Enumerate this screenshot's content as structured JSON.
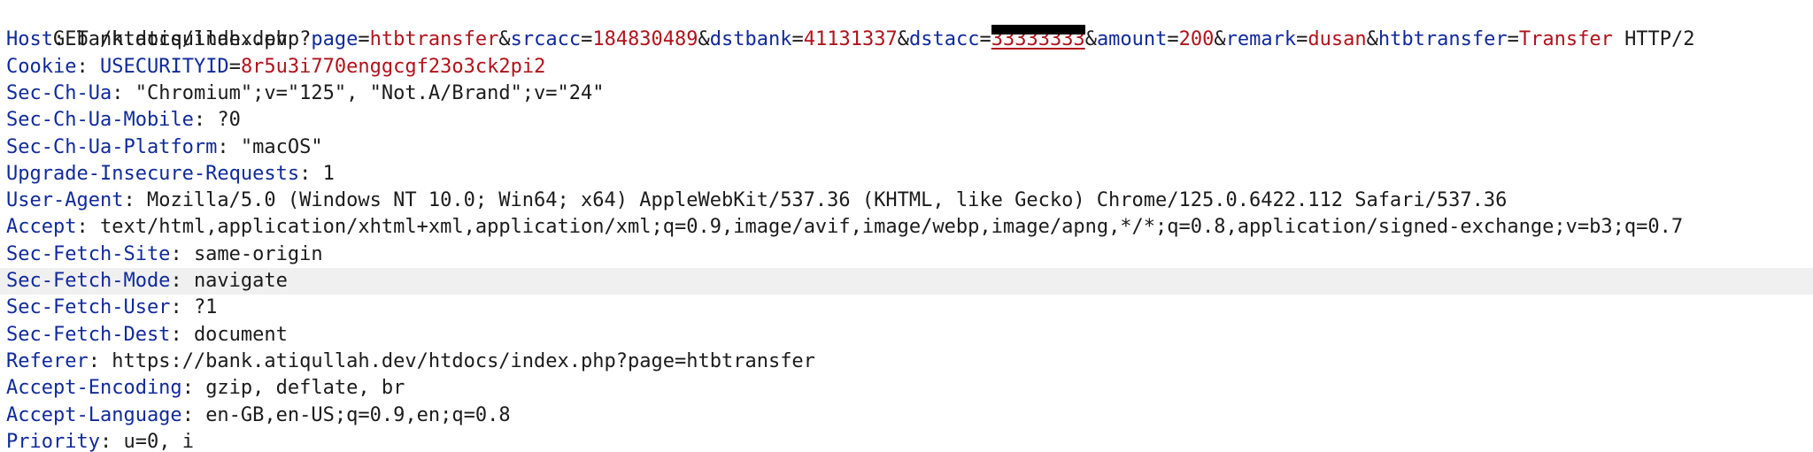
{
  "request_line": {
    "method": "GET",
    "path": "/htdocs/index.php?",
    "params": [
      {
        "sep": "",
        "key": "page",
        "val": "htbtransfer"
      },
      {
        "sep": "&",
        "key": "srcacc",
        "val": "184830489"
      },
      {
        "sep": "&",
        "key": "dstbank",
        "val": "41131337"
      },
      {
        "sep": "&",
        "key": "dstacc",
        "val": "33333333"
      },
      {
        "sep": "&",
        "key": "amount",
        "val": "200"
      },
      {
        "sep": "&",
        "key": "remark",
        "val": "dusan"
      },
      {
        "sep": "&",
        "key": "htbtransfer",
        "val": "Transfer"
      }
    ],
    "protocol": "HTTP/2"
  },
  "headers": [
    {
      "name": "Host",
      "value": "bank.atiqullah.dev"
    },
    {
      "name": "Cookie",
      "cookie_key": "USECURITYID",
      "cookie_val": "8r5u3i770enggcgf23o3ck2pi2"
    },
    {
      "name": "Sec-Ch-Ua",
      "value": "\"Chromium\";v=\"125\", \"Not.A/Brand\";v=\"24\""
    },
    {
      "name": "Sec-Ch-Ua-Mobile",
      "value": "?0"
    },
    {
      "name": "Sec-Ch-Ua-Platform",
      "value": "\"macOS\""
    },
    {
      "name": "Upgrade-Insecure-Requests",
      "value": "1"
    },
    {
      "name": "User-Agent",
      "value": "Mozilla/5.0 (Windows NT 10.0; Win64; x64) AppleWebKit/537.36 (KHTML, like Gecko) Chrome/125.0.6422.112 Safari/537.36"
    },
    {
      "name": "Accept",
      "value": "text/html,application/xhtml+xml,application/xml;q=0.9,image/avif,image/webp,image/apng,*/*;q=0.8,application/signed-exchange;v=b3;q=0.7"
    },
    {
      "name": "Sec-Fetch-Site",
      "value": "same-origin"
    },
    {
      "name": "Sec-Fetch-Mode",
      "value": "navigate"
    },
    {
      "name": "Sec-Fetch-User",
      "value": "?1"
    },
    {
      "name": "Sec-Fetch-Dest",
      "value": "document"
    },
    {
      "name": "Referer",
      "value": "https://bank.atiqullah.dev/htdocs/index.php?page=htbtransfer"
    },
    {
      "name": "Accept-Encoding",
      "value": "gzip, deflate, br"
    },
    {
      "name": "Accept-Language",
      "value": "en-GB,en-US;q=0.9,en;q=0.8"
    },
    {
      "name": "Priority",
      "value": "u=0, i"
    }
  ],
  "colors": {
    "key": "#102a9b",
    "value": "#b1121b",
    "text": "#1b1b1b",
    "highlight": "#f0f0f0",
    "redaction": "#000000"
  }
}
